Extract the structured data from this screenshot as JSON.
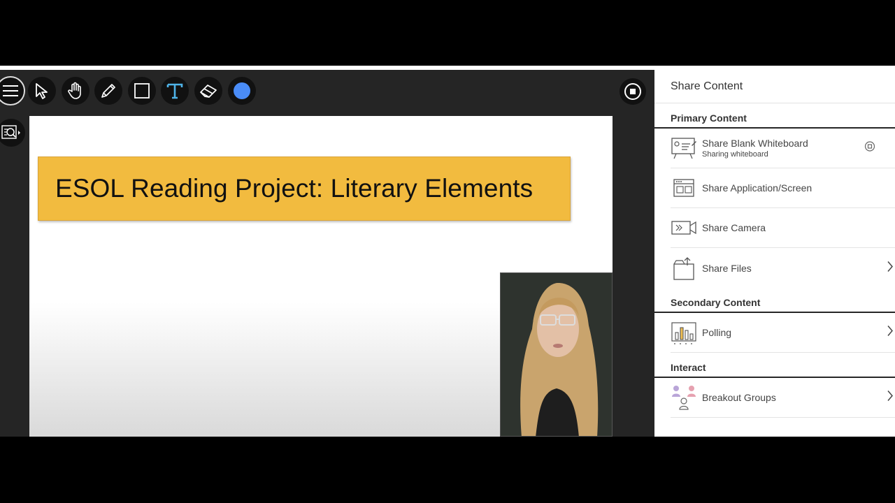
{
  "toolbar": {
    "tools": [
      "menu-icon",
      "select-icon",
      "pan-icon",
      "pencil-icon",
      "rectangle-icon",
      "text-icon",
      "eraser-icon",
      "color-picker"
    ],
    "accent_color": "#4a8cf7",
    "text_tool_color": "#4fb3e8"
  },
  "slide": {
    "title": "ESOL Reading Project: Literary Elements",
    "banner_color": "#f2bb3f"
  },
  "panel": {
    "title": "Share Content",
    "primary": {
      "label": "Primary Content",
      "items": [
        {
          "label": "Share Blank Whiteboard",
          "sub": "Sharing whiteboard"
        },
        {
          "label": "Share Application/Screen"
        },
        {
          "label": "Share Camera"
        },
        {
          "label": "Share Files"
        }
      ]
    },
    "secondary": {
      "label": "Secondary Content",
      "items": [
        {
          "label": "Polling"
        }
      ]
    },
    "interact": {
      "label": "Interact",
      "items": [
        {
          "label": "Breakout Groups"
        }
      ]
    }
  }
}
